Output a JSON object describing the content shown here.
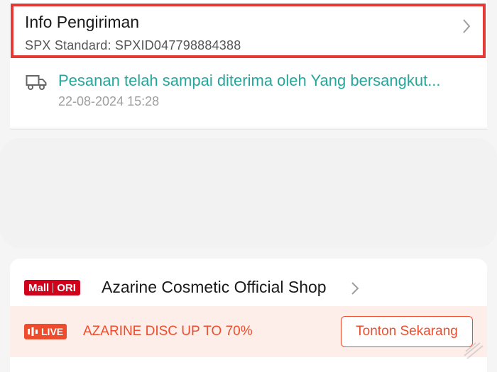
{
  "shipping": {
    "title": "Info Pengiriman",
    "service": "SPX Standard: SPXID047798884388"
  },
  "tracking": {
    "status": "Pesanan telah sampai diterima oleh Yang bersangkut...",
    "timestamp": "22-08-2024 15:28",
    "icon": "truck-icon"
  },
  "shop": {
    "badge_mall": "Mall",
    "badge_ori": "ORI",
    "name": "Azarine Cosmetic Official Shop"
  },
  "live": {
    "badge_label": "LIVE",
    "promo_text": "AZARINE DISC UP TO 70%",
    "button_label": "Tonton Sekarang"
  },
  "colors": {
    "highlight_border": "#e53935",
    "status_green": "#26a69a",
    "brand_orange": "#ee4d2d",
    "mall_red": "#d0011b"
  }
}
